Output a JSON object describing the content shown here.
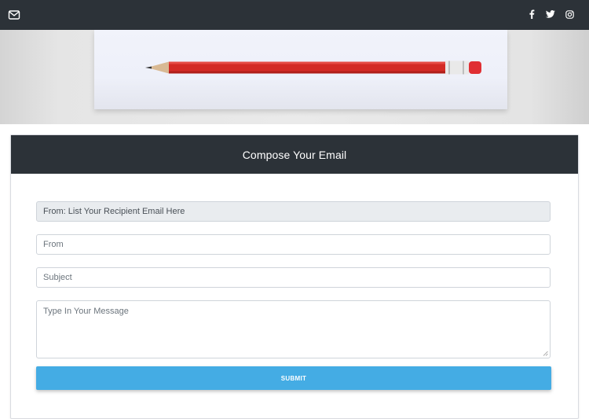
{
  "navbar": {
    "icons": [
      "envelope-icon",
      "facebook-icon",
      "twitter-icon",
      "instagram-icon"
    ],
    "background": "#2c3238"
  },
  "hero": {
    "image": "pencil-on-envelope"
  },
  "form": {
    "title": "Compose Your Email",
    "recipient_value": "From: List Your Recipient Email Here",
    "from_placeholder": "From",
    "subject_placeholder": "Subject",
    "message_placeholder": "Type In Your Message",
    "submit_label": "SUBMIT"
  },
  "colors": {
    "header_bg": "#2c3238",
    "submit_bg": "#44ace4",
    "readonly_bg": "#e9ecef"
  }
}
